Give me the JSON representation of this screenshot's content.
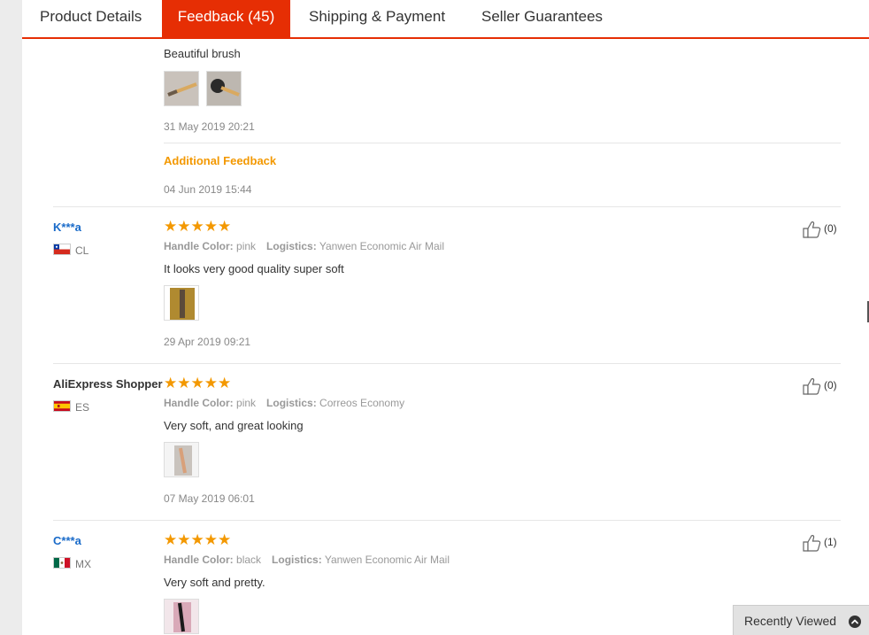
{
  "tabs": [
    {
      "label": "Product Details",
      "active": false
    },
    {
      "label": "Feedback (45)",
      "active": true
    },
    {
      "label": "Shipping & Payment",
      "active": false
    },
    {
      "label": "Seller Guarantees",
      "active": false
    }
  ],
  "first_feedback": {
    "text": "Beautiful brush",
    "date": "31 May 2019 20:21",
    "additional_label": "Additional Feedback",
    "additional_date": "04 Jun 2019 15:44"
  },
  "reviews": [
    {
      "name": "K***a",
      "country": "CL",
      "stars": "★★★★★",
      "handle_label": "Handle Color:",
      "handle_value": "pink",
      "logistics_label": "Logistics:",
      "logistics_value": "Yanwen Economic Air Mail",
      "text": "It looks very good quality super soft",
      "date": "29 Apr 2019 09:21",
      "likes": "(0)"
    },
    {
      "name": "AliExpress Shopper",
      "country": "ES",
      "stars": "★★★★★",
      "handle_label": "Handle Color:",
      "handle_value": "pink",
      "logistics_label": "Logistics:",
      "logistics_value": "Correos Economy",
      "text": "Very soft, and great looking",
      "date": "07 May 2019 06:01",
      "likes": "(0)"
    },
    {
      "name": "C***a",
      "country": "MX",
      "stars": "★★★★★",
      "handle_label": "Handle Color:",
      "handle_value": "black",
      "logistics_label": "Logistics:",
      "logistics_value": "Yanwen Economic Air Mail",
      "text": "Very soft and pretty.",
      "likes": "(1)"
    }
  ],
  "recently_viewed": {
    "label": "Recently Viewed"
  },
  "colors": {
    "accent": "#e62e04",
    "star": "#f39800",
    "link": "#1a6bc9"
  },
  "icons": [
    "thumbs-up-icon",
    "chevron-up-icon",
    "chile-flag-icon",
    "spain-flag-icon",
    "mexico-flag-icon"
  ]
}
